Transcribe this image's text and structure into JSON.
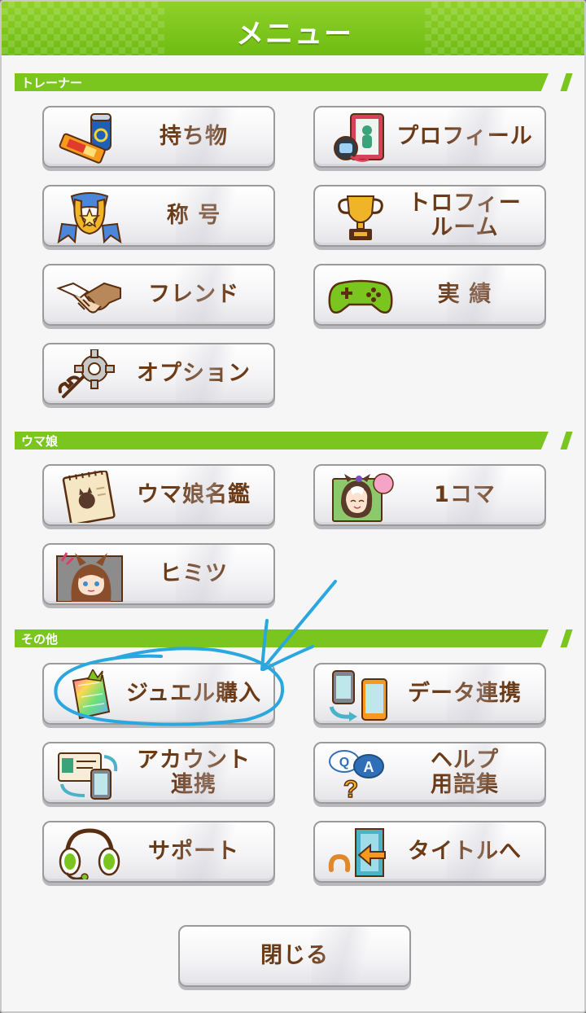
{
  "header": {
    "title": "メニュー"
  },
  "sections": {
    "trainer": "トレーナー",
    "umamusume": "ウマ娘",
    "other": "その他"
  },
  "buttons": {
    "items": "持ち物",
    "profile": "プロフィール",
    "title": "称 号",
    "trophy_room": "トロフィー\nルーム",
    "friend": "フレンド",
    "achievements": "実 績",
    "options": "オプション",
    "encyclopedia": "ウマ娘名鑑",
    "one_koma": "1コマ",
    "secrets": "ヒミツ",
    "jewel_purchase": "ジュエル購入",
    "data_link": "データ連携",
    "account_link": "アカウント\n連携",
    "help_glossary": "ヘルプ\n用語集",
    "support": "サポート",
    "to_title": "タイトルへ",
    "close": "閉じる"
  },
  "colors": {
    "accent_green": "#7bc51f",
    "label_brown": "#6b3a17",
    "annotation_blue": "#2ba7e0"
  },
  "icons": {
    "items": "snack-and-can-icon",
    "profile": "profile-card-icon",
    "title": "horseshoe-badge-icon",
    "trophy_room": "trophy-icon",
    "friend": "handshake-icon",
    "achievements": "gamepad-icon",
    "options": "gear-wrench-icon",
    "encyclopedia": "notebook-icon",
    "one_koma": "character-photo-icon",
    "secrets": "character-portrait-icon",
    "jewel_purchase": "jewel-bag-icon",
    "data_link": "phones-transfer-icon",
    "account_link": "id-card-phone-icon",
    "help_glossary": "qa-bubbles-icon",
    "support": "headset-icon",
    "to_title": "exit-door-icon"
  }
}
